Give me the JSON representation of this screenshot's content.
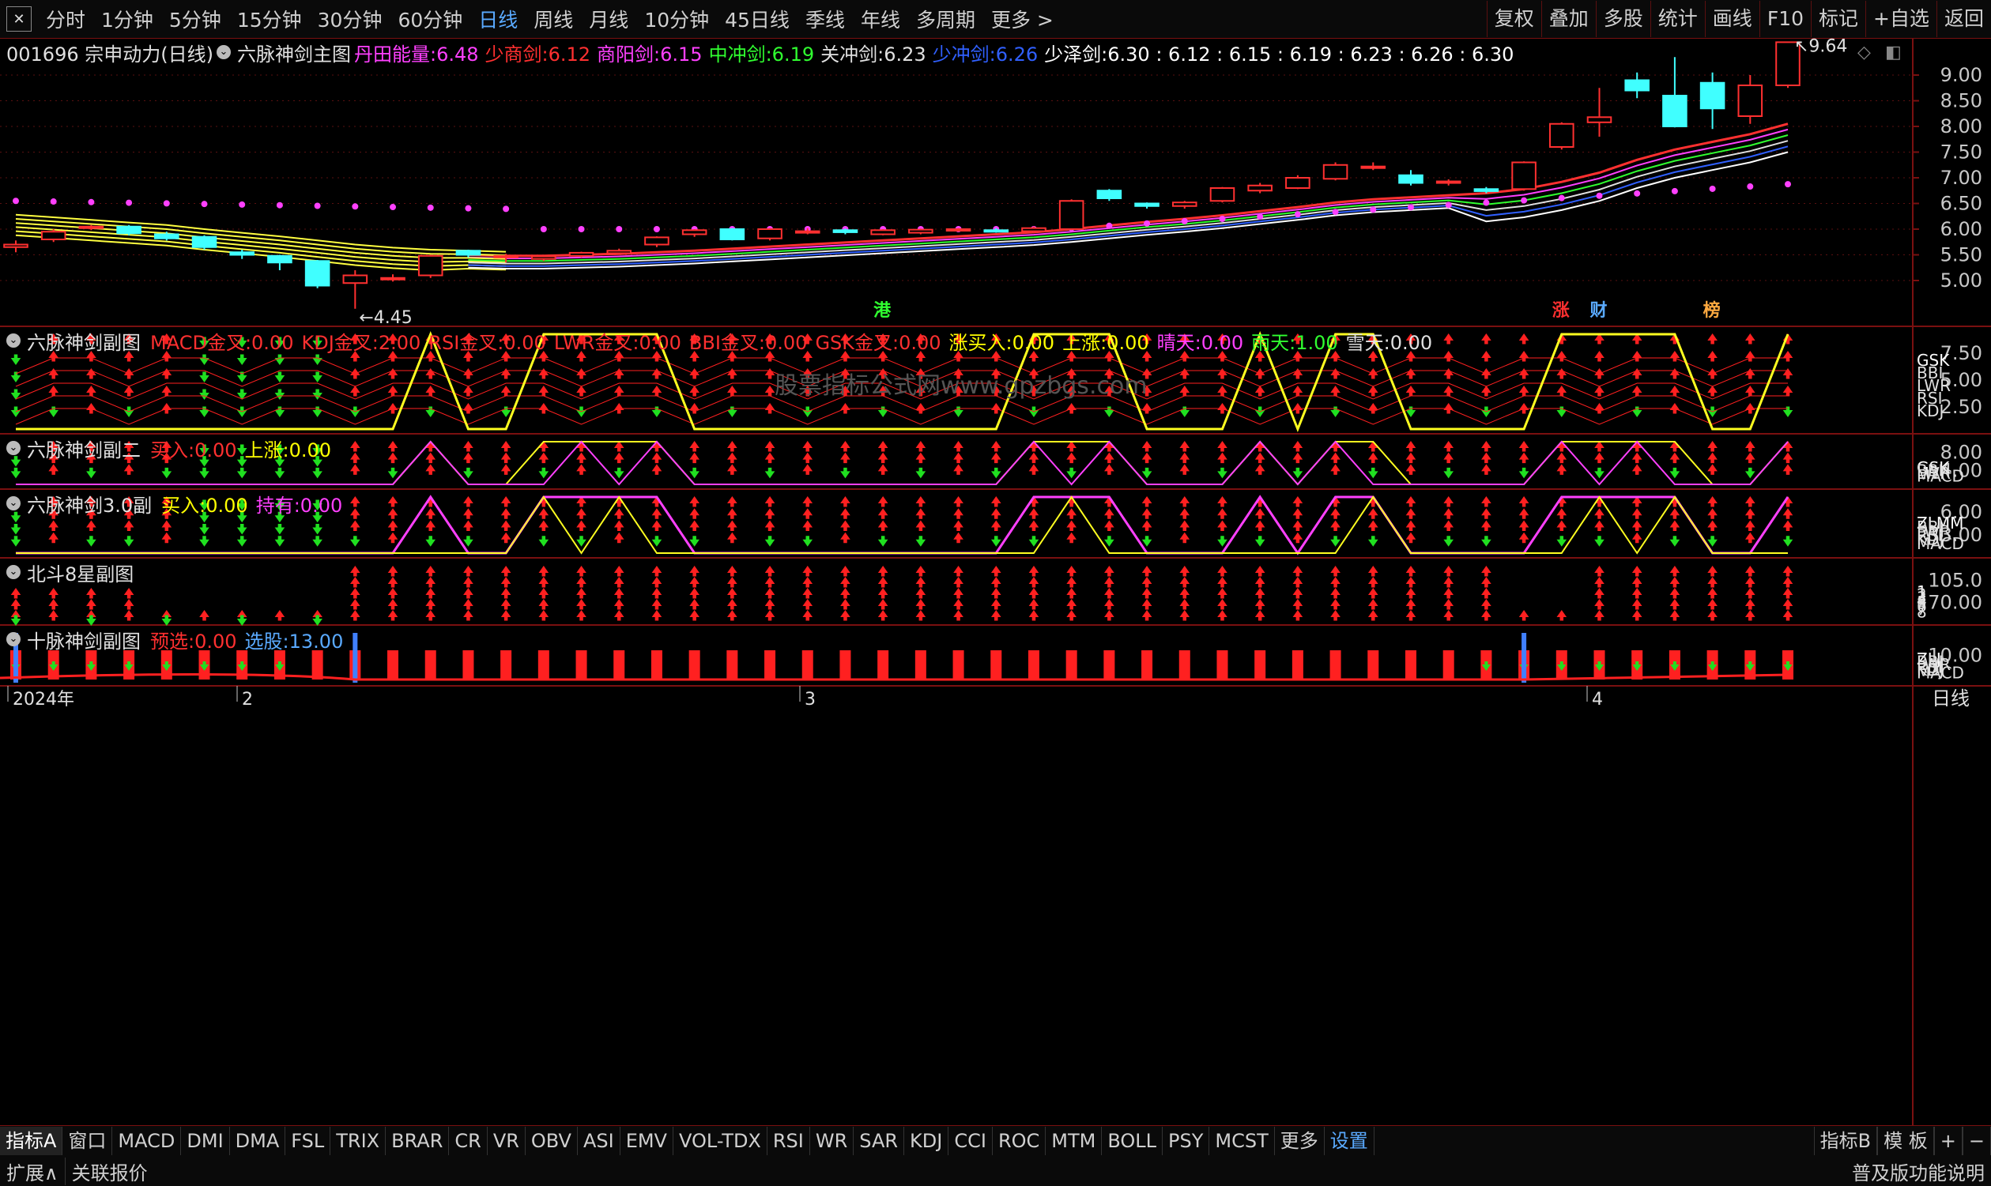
{
  "topbar": {
    "periods": [
      "分时",
      "1分钟",
      "5分钟",
      "15分钟",
      "30分钟",
      "60分钟",
      "日线",
      "周线",
      "月线",
      "10分钟",
      "45日线",
      "季线",
      "年线",
      "多周期",
      "更多 >"
    ],
    "active_period": "日线",
    "right_buttons": [
      "复权",
      "叠加",
      "多股",
      "统计",
      "画线",
      "F10",
      "标记",
      "+自选",
      "返回"
    ]
  },
  "main_chart": {
    "stock": "001696 宗申动力(日线)",
    "indicator": "六脉神剑主图",
    "values": [
      {
        "label": "丹田能量:",
        "value": "6.48",
        "color": "#ff40ff"
      },
      {
        "label": "少商剑:",
        "value": "6.12",
        "color": "#ff3030"
      },
      {
        "label": "商阳剑:",
        "value": "6.15",
        "color": "#ff40ff"
      },
      {
        "label": "中冲剑:",
        "value": "6.19",
        "color": "#30ff30"
      },
      {
        "label": "关冲剑:",
        "value": "6.23",
        "color": "#e0e0e0"
      },
      {
        "label": "少冲剑:",
        "value": "6.26",
        "color": "#3060ff"
      },
      {
        "label": "少泽剑:",
        "value": "6.30 : 6.12 : 6.15 : 6.19 : 6.23 : 6.26 : 6.30",
        "color": "#ffffff"
      }
    ],
    "y_ticks": [
      "9.00",
      "8.50",
      "8.00",
      "7.50",
      "7.00",
      "6.50",
      "6.00",
      "5.50",
      "5.00"
    ],
    "max_label": "9.64",
    "min_label": "4.45",
    "event_marks": [
      "港",
      "涨",
      "财",
      "榜"
    ]
  },
  "chart_data": {
    "type": "candlestick",
    "candles": [
      [
        5.65,
        5.7,
        5.55,
        5.78
      ],
      [
        5.8,
        5.95,
        5.75,
        6.0
      ],
      [
        6.02,
        6.05,
        5.98,
        6.08
      ],
      [
        6.05,
        5.92,
        5.88,
        6.08
      ],
      [
        5.9,
        5.82,
        5.78,
        5.95
      ],
      [
        5.85,
        5.65,
        5.6,
        5.88
      ],
      [
        5.55,
        5.5,
        5.42,
        5.6
      ],
      [
        5.48,
        5.35,
        5.2,
        5.5
      ],
      [
        5.38,
        4.9,
        4.85,
        5.4
      ],
      [
        4.95,
        5.1,
        4.45,
        5.2
      ],
      [
        5.02,
        5.05,
        4.98,
        5.12
      ],
      [
        5.1,
        5.48,
        5.05,
        5.5
      ],
      [
        5.58,
        5.5,
        5.45,
        5.6
      ],
      [
        5.45,
        5.48,
        5.35,
        5.52
      ],
      [
        5.42,
        5.47,
        5.38,
        5.5
      ],
      [
        5.48,
        5.54,
        5.45,
        5.56
      ],
      [
        5.53,
        5.58,
        5.5,
        5.62
      ],
      [
        5.7,
        5.84,
        5.65,
        5.86
      ],
      [
        5.9,
        5.98,
        5.85,
        6.0
      ],
      [
        6.0,
        5.8,
        5.78,
        6.02
      ],
      [
        5.82,
        6.0,
        5.78,
        6.02
      ],
      [
        5.96,
        5.96,
        5.9,
        6.02
      ],
      [
        5.98,
        5.94,
        5.9,
        6.01
      ],
      [
        5.9,
        5.98,
        5.88,
        6.0
      ],
      [
        5.93,
        5.99,
        5.9,
        6.01
      ],
      [
        5.97,
        6.0,
        5.95,
        6.02
      ],
      [
        5.98,
        5.97,
        5.93,
        6.02
      ],
      [
        5.96,
        6.02,
        5.92,
        6.05
      ],
      [
        6.0,
        6.55,
        5.98,
        6.58
      ],
      [
        6.75,
        6.6,
        6.55,
        6.78
      ],
      [
        6.5,
        6.45,
        6.4,
        6.52
      ],
      [
        6.45,
        6.52,
        6.4,
        6.55
      ],
      [
        6.55,
        6.8,
        6.52,
        6.82
      ],
      [
        6.75,
        6.85,
        6.7,
        6.9
      ],
      [
        6.8,
        7.0,
        6.78,
        7.05
      ],
      [
        6.98,
        7.25,
        6.95,
        7.3
      ],
      [
        7.2,
        7.22,
        7.15,
        7.3
      ],
      [
        7.05,
        6.9,
        6.85,
        7.15
      ],
      [
        6.9,
        6.93,
        6.85,
        6.97
      ],
      [
        6.78,
        6.74,
        6.7,
        6.82
      ],
      [
        6.78,
        7.3,
        6.75,
        7.32
      ],
      [
        7.6,
        8.05,
        7.55,
        8.08
      ],
      [
        8.08,
        8.18,
        7.8,
        8.75
      ],
      [
        8.9,
        8.7,
        8.55,
        9.05
      ],
      [
        8.6,
        8.0,
        7.98,
        9.35
      ],
      [
        8.85,
        8.35,
        7.95,
        9.05
      ],
      [
        8.2,
        8.8,
        8.05,
        9.0
      ],
      [
        8.8,
        9.64,
        8.75,
        9.64
      ]
    ],
    "lows_label": "4.45",
    "highs_label": "9.64",
    "ylim": [
      4.45,
      9.64
    ],
    "series": [
      {
        "name": "丹田能量",
        "color": "#ff40ff",
        "style": "dots"
      },
      {
        "name": "少商剑",
        "color": "#ff3030"
      },
      {
        "name": "商阳剑",
        "color": "#ff40ff"
      },
      {
        "name": "中冲剑",
        "color": "#30ff30"
      },
      {
        "name": "关冲剑",
        "color": "#e0e0e0"
      },
      {
        "name": "少冲剑",
        "color": "#3060ff"
      },
      {
        "name": "少泽剑",
        "color": "#ffffff"
      }
    ]
  },
  "subcharts": [
    {
      "title": "六脉神剑副图",
      "items": [
        {
          "label": "MACD金叉:",
          "value": "0.00",
          "color": "#ff3030"
        },
        {
          "label": "KDJ金叉:",
          "value": "2.00",
          "color": "#ff3030"
        },
        {
          "label": "RSI金叉:",
          "value": "0.00",
          "color": "#ff3030"
        },
        {
          "label": "LWR金叉:",
          "value": "0.00",
          "color": "#ff3030"
        },
        {
          "label": "BBI金叉:",
          "value": "0.00",
          "color": "#ff3030"
        },
        {
          "label": "GSK金叉:",
          "value": "0.00",
          "color": "#ff3030"
        },
        {
          "label": "涨买入:",
          "value": "0.00",
          "color": "#ffff00"
        },
        {
          "label": "上涨:",
          "value": "0.00",
          "color": "#ffff00"
        },
        {
          "label": "晴天:",
          "value": "0.00",
          "color": "#ff40ff"
        },
        {
          "label": "雨天:",
          "value": "1.00",
          "color": "#30ff30"
        },
        {
          "label": "雪天:",
          "value": "0.00",
          "color": "#e0e0e0"
        }
      ],
      "y_ticks": [
        "7.50",
        "5.00",
        "2.50"
      ],
      "legend": [
        "GSK",
        "BBI",
        "LWR",
        "RSI",
        "KDJ"
      ],
      "watermark": "股票指标公式网www.gpzbgs.com"
    },
    {
      "title": "六脉神剑副二",
      "items": [
        {
          "label": "买入:",
          "value": "0.00",
          "color": "#ff3030"
        },
        {
          "label": "上涨:",
          "value": "0.00",
          "color": "#ffff00"
        }
      ],
      "y_ticks": [
        "8.00",
        "4.00"
      ],
      "legend": [
        "GSK",
        "BBI",
        "LWR",
        "MACD"
      ]
    },
    {
      "title": "六脉神剑3.0副",
      "items": [
        {
          "label": "买入:",
          "value": "0.00",
          "color": "#ffff00"
        },
        {
          "label": "持有:",
          "value": "0.00",
          "color": "#ff40ff"
        }
      ],
      "y_ticks": [
        "6.00",
        "3.00"
      ],
      "legend": [
        "ZLMM",
        "BBI",
        "LWR",
        "RSI",
        "KDJ",
        "MACD"
      ]
    },
    {
      "title": "北斗8星副图",
      "items": [],
      "y_ticks": [
        "105.0",
        "70.00"
      ],
      "legend": [
        "1",
        "2",
        "3",
        "4",
        "5",
        "6",
        "7",
        "8"
      ]
    },
    {
      "title": "十脉神剑副图",
      "items": [
        {
          "label": "预选:",
          "value": "0.00",
          "color": "#ff3030"
        },
        {
          "label": "选股:",
          "value": "13.00",
          "color": "#5aaaff"
        }
      ],
      "y_ticks": [
        "10.00"
      ],
      "legend": [
        "ZLJ",
        "BBI",
        "LWR",
        "RSI",
        "KDJ",
        "MACD"
      ]
    }
  ],
  "date_axis": {
    "labels": [
      "2024年",
      "2",
      "3",
      "4"
    ],
    "right_label": "日线"
  },
  "bottom_tabs": [
    "指标A",
    "窗口",
    "MACD",
    "DMI",
    "DMA",
    "FSL",
    "TRIX",
    "BRAR",
    "CR",
    "VR",
    "OBV",
    "ASI",
    "EMV",
    "VOL-TDX",
    "RSI",
    "WR",
    "SAR",
    "KDJ",
    "CCI",
    "ROC",
    "MTM",
    "BOLL",
    "PSY",
    "MCST",
    "更多",
    "设置"
  ],
  "bottom_right": [
    "指标B",
    "模 板",
    "+",
    "−"
  ],
  "status": {
    "left": [
      "扩展∧",
      "关联报价"
    ],
    "right": "普及版功能说明"
  }
}
